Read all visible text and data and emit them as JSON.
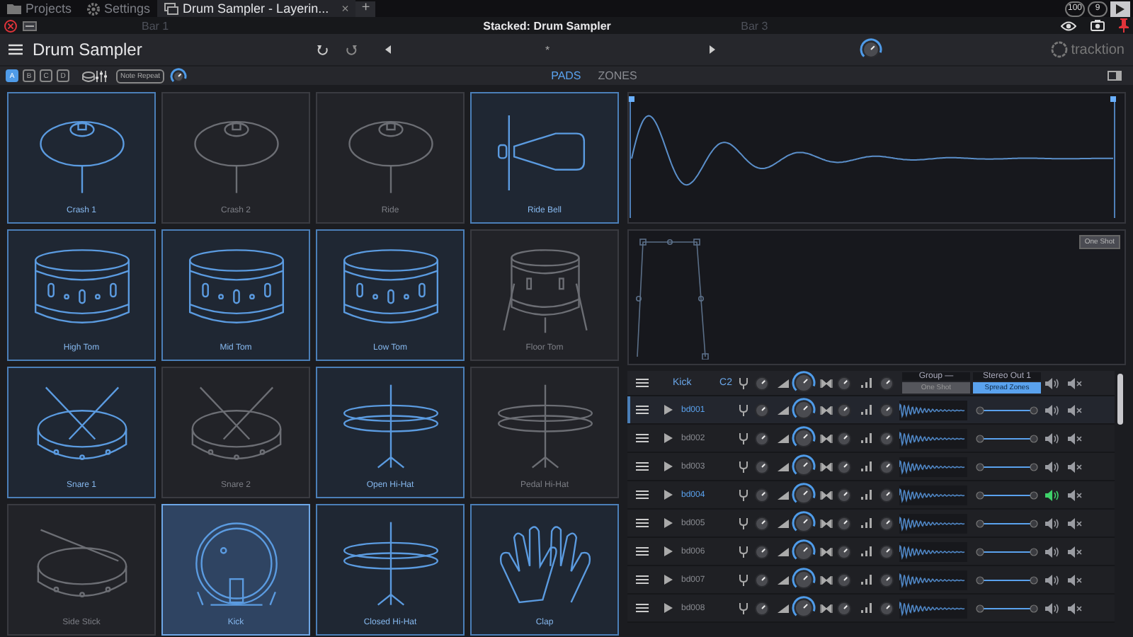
{
  "app_tabs": [
    {
      "label": "Projects",
      "kind": "folder",
      "selected": false
    },
    {
      "label": "Settings",
      "kind": "gear",
      "selected": false
    },
    {
      "label": "Drum Sampler - Layerin...",
      "kind": "plugin",
      "selected": true,
      "close": "×"
    }
  ],
  "add_tab": "+",
  "counters": [
    "100",
    "9"
  ],
  "window": {
    "title": "Stacked: Drum Sampler",
    "bars": [
      "Bar 1",
      "Bar 3"
    ]
  },
  "toolbar": {
    "title": "Drum Sampler",
    "marker": "*",
    "brand": "tracktion"
  },
  "banks": [
    {
      "label": "A",
      "selected": true
    },
    {
      "label": "B",
      "selected": false
    },
    {
      "label": "C",
      "selected": false
    },
    {
      "label": "D",
      "selected": false
    }
  ],
  "note_repeat": "Note Repeat",
  "view_tabs": [
    {
      "label": "PADS",
      "selected": true
    },
    {
      "label": "ZONES",
      "selected": false
    }
  ],
  "pads": [
    {
      "label": "Crash 1",
      "kind": "cymbal",
      "loaded": true,
      "selected": false
    },
    {
      "label": "Crash 2",
      "kind": "cymbal",
      "loaded": false,
      "selected": false
    },
    {
      "label": "Ride",
      "kind": "cymbal",
      "loaded": false,
      "selected": false
    },
    {
      "label": "Ride Bell",
      "kind": "bell",
      "loaded": true,
      "selected": false
    },
    {
      "label": "High Tom",
      "kind": "tom",
      "loaded": true,
      "selected": false
    },
    {
      "label": "Mid Tom",
      "kind": "tom",
      "loaded": true,
      "selected": false
    },
    {
      "label": "Low Tom",
      "kind": "tom",
      "loaded": true,
      "selected": false
    },
    {
      "label": "Floor Tom",
      "kind": "floortom",
      "loaded": false,
      "selected": false
    },
    {
      "label": "Snare 1",
      "kind": "snare",
      "loaded": true,
      "selected": false
    },
    {
      "label": "Snare 2",
      "kind": "snare",
      "loaded": false,
      "selected": false
    },
    {
      "label": "Open Hi-Hat",
      "kind": "hihat",
      "loaded": true,
      "selected": false
    },
    {
      "label": "Pedal Hi-Hat",
      "kind": "hihat",
      "loaded": false,
      "selected": false
    },
    {
      "label": "Side Stick",
      "kind": "sidestick",
      "loaded": false,
      "selected": false
    },
    {
      "label": "Kick",
      "kind": "kick",
      "loaded": true,
      "selected": true
    },
    {
      "label": "Closed Hi-Hat",
      "kind": "hihat",
      "loaded": true,
      "selected": false
    },
    {
      "label": "Clap",
      "kind": "clap",
      "loaded": true,
      "selected": false
    }
  ],
  "envelope": {
    "mode_button": "One Shot"
  },
  "zone_header": {
    "name": "Kick",
    "note": "C2",
    "group": "Group —",
    "group_mode": "One Shot",
    "output": "Stereo Out 1",
    "spread": "Spread Zones",
    "spread_on": true
  },
  "samples": [
    {
      "name": "bd001",
      "active": true,
      "selected": true,
      "solo": false
    },
    {
      "name": "bd002",
      "active": false,
      "selected": false,
      "solo": false
    },
    {
      "name": "bd003",
      "active": false,
      "selected": false,
      "solo": false
    },
    {
      "name": "bd004",
      "active": true,
      "selected": false,
      "solo": true
    },
    {
      "name": "bd005",
      "active": false,
      "selected": false,
      "solo": false
    },
    {
      "name": "bd006",
      "active": false,
      "selected": false,
      "solo": false
    },
    {
      "name": "bd007",
      "active": false,
      "selected": false,
      "solo": false
    },
    {
      "name": "bd008",
      "active": false,
      "selected": false,
      "solo": false
    }
  ]
}
